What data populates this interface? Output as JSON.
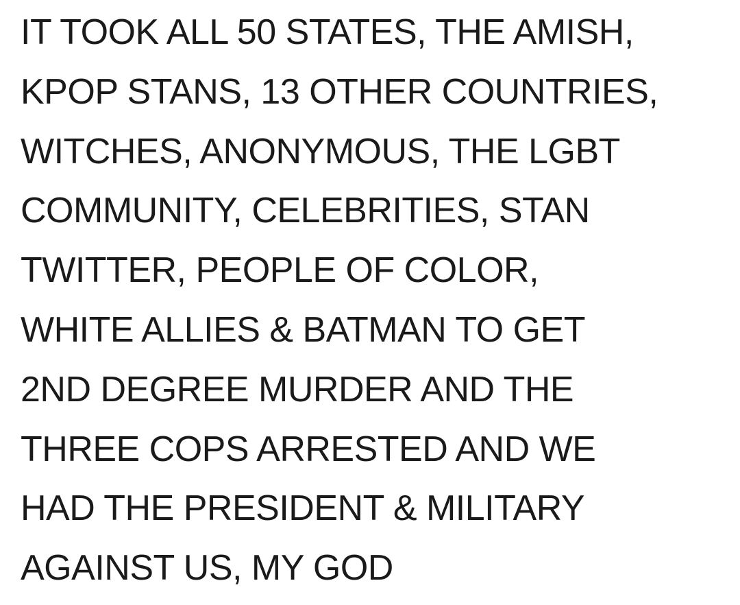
{
  "post": {
    "lines": [
      "IT TOOK ALL 50 STATES, THE AMISH,",
      "KPOP STANS, 13 OTHER COUNTRIES,",
      "WITCHES, ANONYMOUS, THE LGBT",
      "COMMUNITY, CELEBRITIES, STAN",
      "TWITTER, PEOPLE OF COLOR,",
      "WHITE ALLIES & BATMAN TO GET",
      "2ND DEGREE MURDER AND THE",
      "THREE COPS ARRESTED AND WE",
      "HAD THE PRESIDENT & MILITARY",
      "AGAINST US, MY GOD"
    ]
  }
}
